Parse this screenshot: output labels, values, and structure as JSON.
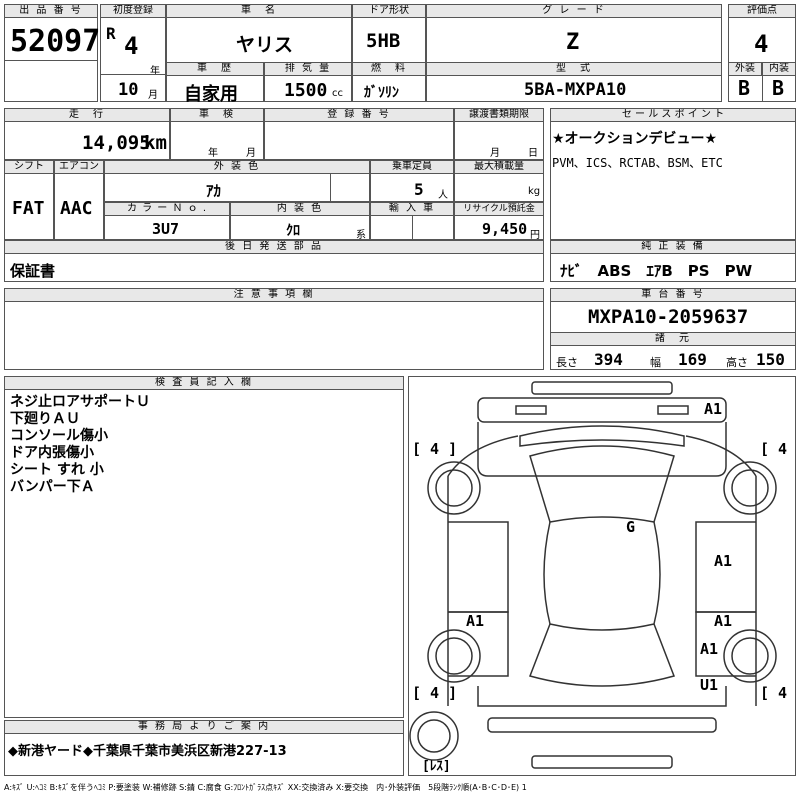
{
  "lot": {
    "label": "出 品 番 号",
    "value": "52097"
  },
  "reg": {
    "label": "初度登録",
    "era": "R",
    "year": "4",
    "year_unit": "年",
    "month": "10",
    "month_unit": "月"
  },
  "car_name": {
    "label": "車　名",
    "value": "ヤリス"
  },
  "door": {
    "label": "ドア形状",
    "value": "5HB"
  },
  "grade": {
    "label": "グ レ ー ド",
    "value": "Z"
  },
  "score": {
    "label": "評価点",
    "value": "4",
    "ext_label": "外装",
    "int_label": "内装",
    "ext_value": "B",
    "int_value": "B"
  },
  "history": {
    "label": "車　歴",
    "value": "自家用"
  },
  "displacement": {
    "label": "排 気 量",
    "value": "1500",
    "unit": "cc"
  },
  "fuel": {
    "label": "燃　料",
    "value": "ｶﾞｿﾘﾝ"
  },
  "model": {
    "label": "型　式",
    "value": "5BA-MXPA10"
  },
  "mileage": {
    "label": "走　行",
    "value": "14,095",
    "unit": "km"
  },
  "inspection": {
    "label": "車　検",
    "year_unit": "年",
    "month_unit": "月"
  },
  "plate": {
    "label": "登 録 番 号"
  },
  "transfer": {
    "label": "譲渡書類期限",
    "month_unit": "月",
    "day_unit": "日"
  },
  "sales": {
    "label": "セ ー ル ス ポ イ ン ト",
    "line1": "★オークションデビュー★",
    "line2": "PVM、ICS、RCTAB、BSM、ETC"
  },
  "shift": {
    "label": "シフト",
    "value": "FAT"
  },
  "aircon": {
    "label": "エアコン",
    "value": "AAC"
  },
  "ext_color": {
    "label": "外 装 色",
    "value": "ｱｶ"
  },
  "capacity": {
    "label": "乗車定員",
    "value": "5",
    "unit": "人"
  },
  "load": {
    "label": "最大積載量",
    "unit": "kg"
  },
  "color_no": {
    "label": "カ ラ ー Ｎ ｏ .",
    "value": "3U7"
  },
  "int_color": {
    "label": "内 装 色",
    "value": "ｸﾛ",
    "unit": "系"
  },
  "import": {
    "label": "輸 入 車"
  },
  "recycle": {
    "label": "リサイクル預託金",
    "value": "9,450",
    "unit": "円"
  },
  "later_parts": {
    "label": "後 日 発 送 部 品",
    "value": "保証書"
  },
  "genuine": {
    "label": "純 正 装 備",
    "value": "ﾅﾋﾞ　ABS　ｴｱB　PS　PW"
  },
  "caution": {
    "label": "注 意 事 項 欄"
  },
  "chassis": {
    "label": "車 台 番 号",
    "value": "MXPA10-2059637"
  },
  "specs": {
    "label": "諸　元",
    "length_label": "長さ",
    "length": "394",
    "width_label": "幅",
    "width": "169",
    "height_label": "高さ",
    "height": "150"
  },
  "inspector": {
    "label": "検 査 員 記 入 欄",
    "lines": [
      "ネジ止ロアサポートＵ",
      "下廻りＡＵ",
      "コンソール傷小",
      "ドア内張傷小",
      "シート すれ 小",
      "バンパー下Ａ"
    ]
  },
  "diagram": {
    "tires": [
      "[ 4 ]",
      "[ 4 ]",
      "[ 4 ]",
      "[ 4 ]"
    ],
    "spare": "[ﾚｽ]",
    "marks": [
      "A1",
      "G",
      "A1",
      "A1",
      "A1",
      "A1",
      "U1"
    ]
  },
  "office": {
    "label": "事 務 局 よ り ご 案 内",
    "value": "◆新港ヤード◆千葉県千葉市美浜区新港227-13"
  },
  "legend": "A:ｷｽﾞ U:ﾍｺﾐ B:ｷｽﾞを伴うﾍｺﾐ P:要塗装 W:補修跡 S:錆 C:腐食 G:ﾌﾛﾝﾄｶﾞﾗｽ点ｷｽﾞ XX:交換済み X:要交換　内･外装評価　5段階ﾗﾝｸ順(A･B･C･D･E) 1"
}
